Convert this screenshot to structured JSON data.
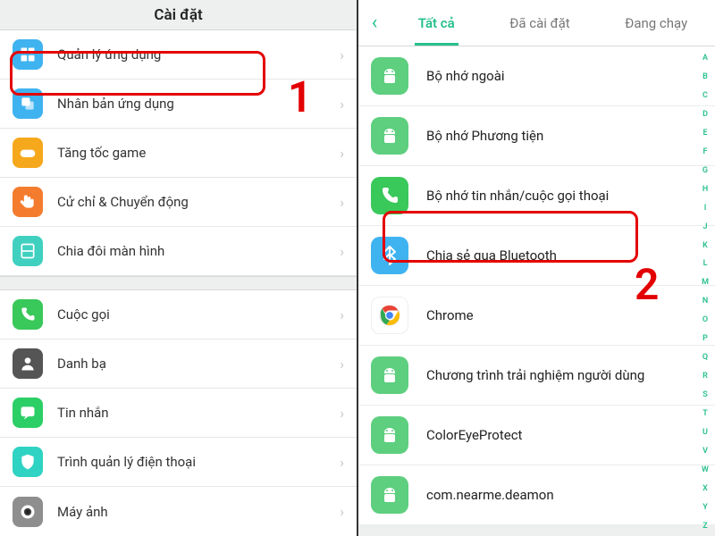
{
  "left": {
    "title": "Cài đặt",
    "section1": [
      {
        "label": "Quản lý ứng dụng",
        "icon": "apps-icon",
        "color": "#3fb3f0"
      },
      {
        "label": "Nhân bản ứng dụng",
        "icon": "clone-icon",
        "color": "#3fb3f0"
      },
      {
        "label": "Tăng tốc game",
        "icon": "gamepad-icon",
        "color": "#f6a81c"
      },
      {
        "label": "Cử chỉ & Chuyển động",
        "icon": "gesture-icon",
        "color": "#f47c2e"
      },
      {
        "label": "Chia đôi màn hình",
        "icon": "split-icon",
        "color": "#3fd0c0"
      }
    ],
    "section2": [
      {
        "label": "Cuộc gọi",
        "icon": "phone-icon",
        "color": "#39c85a"
      },
      {
        "label": "Danh bạ",
        "icon": "contact-icon",
        "color": "#555"
      },
      {
        "label": "Tin nhắn",
        "icon": "message-icon",
        "color": "#2bcf66"
      },
      {
        "label": "Trình quản lý điện thoại",
        "icon": "shield-icon",
        "color": "#2fd3c3"
      },
      {
        "label": "Máy ảnh",
        "icon": "camera-icon",
        "color": "#8e8e8e"
      }
    ]
  },
  "right": {
    "tabs": {
      "all": "Tất cả",
      "installed": "Đã cài đặt",
      "running": "Đang chạy"
    },
    "apps": [
      {
        "label": "Bộ nhớ ngoài",
        "icon": "android-icon",
        "color": "#5dcf7f"
      },
      {
        "label": "Bộ nhớ Phương tiện",
        "icon": "android-icon",
        "color": "#5dcf7f"
      },
      {
        "label": "Bộ nhớ tin nhắn/cuộc gọi thoại",
        "icon": "phone-icon",
        "color": "#39c85a"
      },
      {
        "label": "Chia sẻ qua Bluetooth",
        "icon": "bluetooth-icon",
        "color": "#3fb3f0"
      },
      {
        "label": "Chrome",
        "icon": "chrome-icon",
        "color": "#fff"
      },
      {
        "label": "Chương trình trải nghiệm người dùng",
        "icon": "android-icon",
        "color": "#5dcf7f"
      },
      {
        "label": "ColorEyeProtect",
        "icon": "android-icon",
        "color": "#5dcf7f"
      },
      {
        "label": "com.nearme.deamon",
        "icon": "android-icon",
        "color": "#5dcf7f"
      }
    ]
  },
  "alpha": [
    "A",
    "B",
    "C",
    "D",
    "E",
    "F",
    "G",
    "H",
    "I",
    "J",
    "K",
    "L",
    "M",
    "N",
    "O",
    "P",
    "Q",
    "R",
    "S",
    "T",
    "U",
    "V",
    "W",
    "X",
    "Y",
    "Z"
  ],
  "annotations": {
    "n1": "1",
    "n2": "2"
  }
}
